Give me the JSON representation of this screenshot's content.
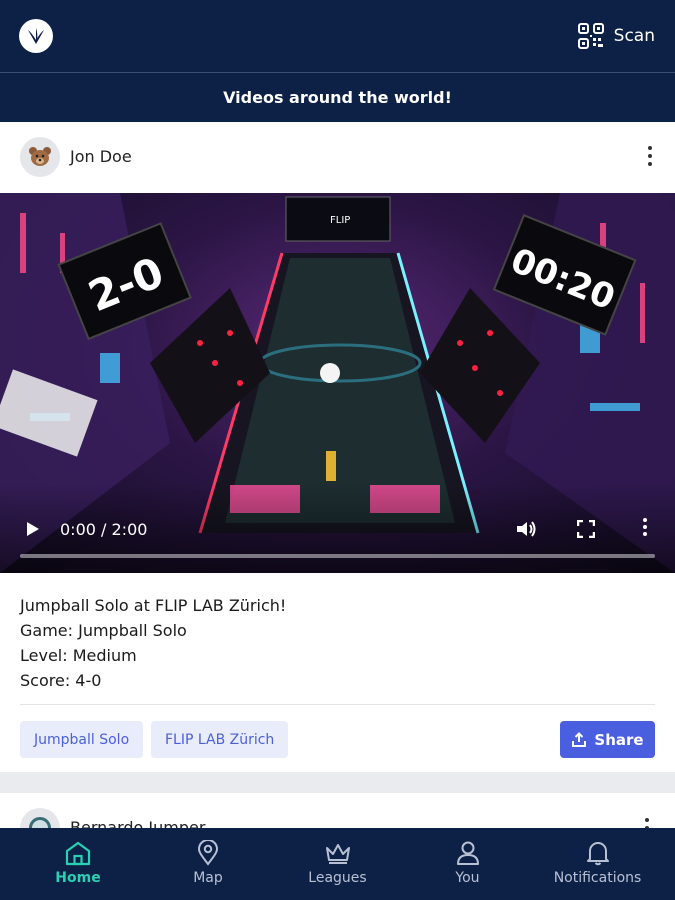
{
  "header": {
    "scan_label": "Scan",
    "banner": "Videos around the world!"
  },
  "post": {
    "author": "Jon Doe",
    "video": {
      "time": "0:00 / 2:00",
      "score_left": "2-0",
      "timer_right": "00:20"
    },
    "title": "Jumpball Solo at FLIP LAB Zürich!",
    "game_line": "Game: Jumpball Solo",
    "level_line": "Level: Medium",
    "score_line": "Score: 4-0",
    "tags": [
      "Jumpball Solo",
      "FLIP LAB Zürich"
    ],
    "share_label": "Share"
  },
  "next_post": {
    "author": "Bernardo Jumper"
  },
  "nav": {
    "items": [
      {
        "label": "Home",
        "icon": "home-icon",
        "active": true
      },
      {
        "label": "Map",
        "icon": "map-pin-icon",
        "active": false
      },
      {
        "label": "Leagues",
        "icon": "crown-icon",
        "active": false
      },
      {
        "label": "You",
        "icon": "user-icon",
        "active": false
      },
      {
        "label": "Notifications",
        "icon": "bell-icon",
        "active": false
      }
    ]
  },
  "colors": {
    "navy": "#0d2045",
    "accent": "#29d1b4",
    "primary": "#4a5ee0",
    "chip_bg": "#e8ecfb"
  }
}
